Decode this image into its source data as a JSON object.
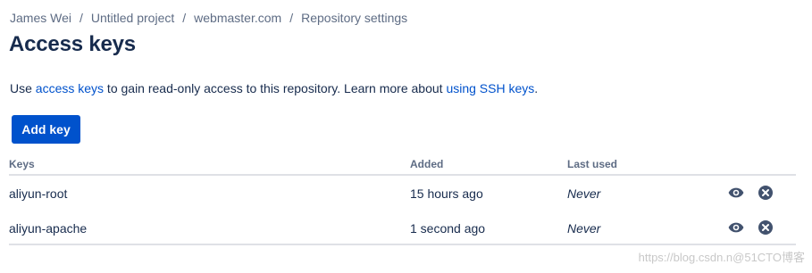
{
  "breadcrumb": {
    "items": [
      "James Wei",
      "Untitled project",
      "webmaster.com",
      "Repository settings"
    ],
    "separator": "/"
  },
  "page": {
    "title": "Access keys"
  },
  "intro": {
    "prefix": "Use ",
    "link1": "access keys",
    "middle": " to gain read-only access to this repository. Learn more about ",
    "link2": "using SSH keys",
    "suffix": "."
  },
  "actions": {
    "add_key_label": "Add key"
  },
  "table": {
    "columns": {
      "keys": "Keys",
      "added": "Added",
      "last_used": "Last used"
    },
    "rows": [
      {
        "key": "aliyun-root",
        "added": "15 hours ago",
        "last_used": "Never"
      },
      {
        "key": "aliyun-apache",
        "added": "1 second ago",
        "last_used": "Never"
      }
    ]
  },
  "icons": {
    "view": "eye-icon",
    "delete": "close-circle-icon"
  },
  "colors": {
    "primary": "#0052cc",
    "text": "#172b4d",
    "muted": "#5e6c84",
    "divider": "#dfe1e6",
    "icon": "#42526e"
  },
  "watermark": "https://blog.csdn.n@51CTO博客"
}
